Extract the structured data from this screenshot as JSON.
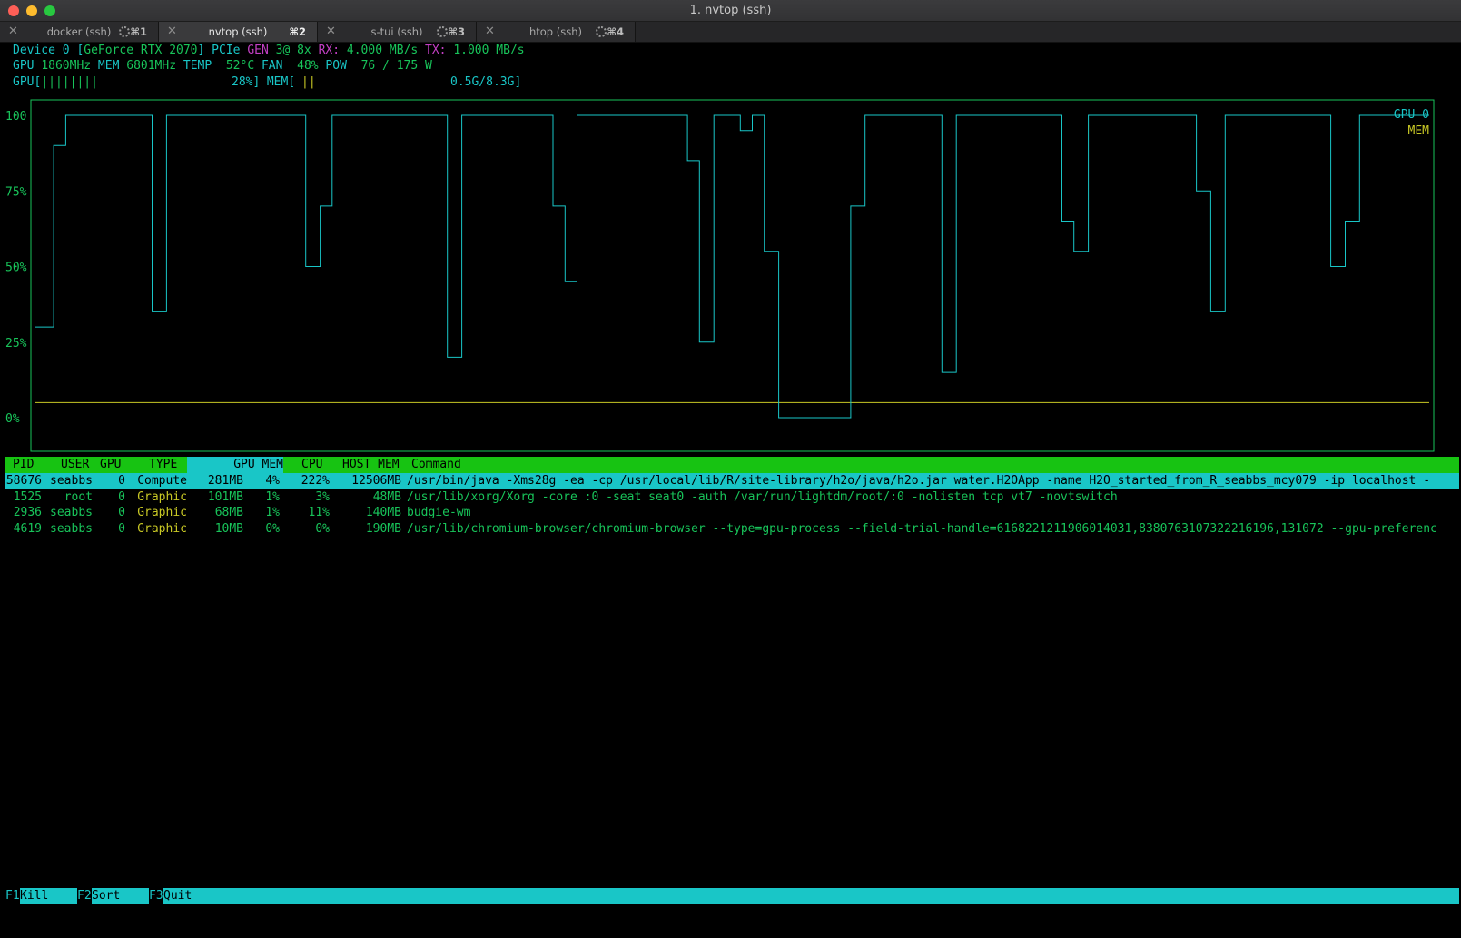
{
  "window": {
    "title": "1. nvtop (ssh)"
  },
  "tabs": [
    {
      "label": "docker (ssh)",
      "shortcut": "⌘1",
      "active": false,
      "busy": true
    },
    {
      "label": "nvtop (ssh)",
      "shortcut": "⌘2",
      "active": true,
      "busy": false
    },
    {
      "label": "s-tui (ssh)",
      "shortcut": "⌘3",
      "active": false,
      "busy": true
    },
    {
      "label": "htop (ssh)",
      "shortcut": "⌘4",
      "active": false,
      "busy": true
    }
  ],
  "device": {
    "prefix": "Device 0 [",
    "name": "GeForce RTX 2070",
    "pcie_label": "] PCIe ",
    "gen_label": "GEN ",
    "gen_value": "3@ 8x ",
    "rx_label": "RX: ",
    "rx_value": "4.000 MB/s ",
    "tx_label": "TX: ",
    "tx_value": "1.000 MB/s"
  },
  "stats": {
    "gpu_label": "GPU ",
    "gpu_clock": "1860MHz",
    "mem_label": " MEM ",
    "mem_clock": "6801MHz",
    "temp_label": " TEMP  ",
    "temp_value": "52°C",
    "fan_label": " FAN  ",
    "fan_value": "48%",
    "pow_label": " POW  ",
    "pow_value": "76 / 175 W"
  },
  "bars": {
    "gpu_label": "GPU[",
    "gpu_bar": "||||||||",
    "gpu_value": "28%]",
    "mem_label": " MEM[",
    "mem_bar": "||",
    "mem_value": "0.5G/8.3G]"
  },
  "chart_data": {
    "type": "line",
    "ylim": [
      0,
      100
    ],
    "yticks": [
      "100",
      "75%",
      "50%",
      "25%",
      "0%"
    ],
    "series": [
      {
        "name": "GPU 0",
        "color": "#19c6c7",
        "values": [
          30,
          30,
          30,
          30,
          30,
          30,
          30,
          30,
          90,
          90,
          90,
          90,
          90,
          100,
          100,
          100,
          100,
          100,
          100,
          100,
          100,
          100,
          100,
          100,
          100,
          100,
          100,
          100,
          100,
          100,
          100,
          100,
          100,
          100,
          100,
          100,
          100,
          100,
          100,
          100,
          100,
          100,
          100,
          100,
          100,
          100,
          100,
          100,
          100,
          35,
          35,
          35,
          35,
          35,
          35,
          100,
          100,
          100,
          100,
          100,
          100,
          100,
          100,
          100,
          100,
          100,
          100,
          100,
          100,
          100,
          100,
          100,
          100,
          100,
          100,
          100,
          100,
          100,
          100,
          100,
          100,
          100,
          100,
          100,
          100,
          100,
          100,
          100,
          100,
          100,
          100,
          100,
          100,
          100,
          100,
          100,
          100,
          100,
          100,
          100,
          100,
          100,
          100,
          100,
          100,
          100,
          100,
          100,
          100,
          100,
          100,
          100,
          100,
          50,
          50,
          50,
          50,
          50,
          50,
          70,
          70,
          70,
          70,
          70,
          100,
          100,
          100,
          100,
          100,
          100,
          100,
          100,
          100,
          100,
          100,
          100,
          100,
          100,
          100,
          100,
          100,
          100,
          100,
          100,
          100,
          100,
          100,
          100,
          100,
          100,
          100,
          100,
          100,
          100,
          100,
          100,
          100,
          100,
          100,
          100,
          100,
          100,
          100,
          100,
          100,
          100,
          100,
          100,
          100,
          100,
          100,
          100,
          20,
          20,
          20,
          20,
          20,
          20,
          100,
          100,
          100,
          100,
          100,
          100,
          100,
          100,
          100,
          100,
          100,
          100,
          100,
          100,
          100,
          100,
          100,
          100,
          100,
          100,
          100,
          100,
          100,
          100,
          100,
          100,
          100,
          100,
          100,
          100,
          100,
          100,
          100,
          100,
          100,
          100,
          100,
          100,
          70,
          70,
          70,
          70,
          70,
          45,
          45,
          45,
          45,
          45,
          100,
          100,
          100,
          100,
          100,
          100,
          100,
          100,
          100,
          100,
          100,
          100,
          100,
          100,
          100,
          100,
          100,
          100,
          100,
          100,
          100,
          100,
          100,
          100,
          100,
          100,
          100,
          100,
          100,
          100,
          100,
          100,
          100,
          100,
          100,
          100,
          100,
          100,
          100,
          100,
          100,
          100,
          100,
          100,
          100,
          100,
          85,
          85,
          85,
          85,
          85,
          25,
          25,
          25,
          25,
          25,
          25,
          100,
          100,
          100,
          100,
          100,
          100,
          100,
          100,
          100,
          100,
          100,
          95,
          95,
          95,
          95,
          95,
          100,
          100,
          100,
          100,
          100,
          55,
          55,
          55,
          55,
          55,
          55,
          0,
          0,
          0,
          0,
          0,
          0,
          0,
          0,
          0,
          0,
          0,
          0,
          0,
          0,
          0,
          0,
          0,
          0,
          0,
          0,
          0,
          0,
          0,
          0,
          0,
          0,
          0,
          0,
          0,
          0,
          70,
          70,
          70,
          70,
          70,
          70,
          100,
          100,
          100,
          100,
          100,
          100,
          100,
          100,
          100,
          100,
          100,
          100,
          100,
          100,
          100,
          100,
          100,
          100,
          100,
          100,
          100,
          100,
          100,
          100,
          100,
          100,
          100,
          100,
          100,
          100,
          100,
          100,
          15,
          15,
          15,
          15,
          15,
          15,
          100,
          100,
          100,
          100,
          100,
          100,
          100,
          100,
          100,
          100,
          100,
          100,
          100,
          100,
          100,
          100,
          100,
          100,
          100,
          100,
          100,
          100,
          100,
          100,
          100,
          100,
          100,
          100,
          100,
          100,
          100,
          100,
          100,
          100,
          100,
          100,
          100,
          100,
          100,
          100,
          100,
          100,
          100,
          100,
          65,
          65,
          65,
          65,
          65,
          55,
          55,
          55,
          55,
          55,
          55,
          100,
          100,
          100,
          100,
          100,
          100,
          100,
          100,
          100,
          100,
          100,
          100,
          100,
          100,
          100,
          100,
          100,
          100,
          100,
          100,
          100,
          100,
          100,
          100,
          100,
          100,
          100,
          100,
          100,
          100,
          100,
          100,
          100,
          100,
          100,
          100,
          100,
          100,
          100,
          100,
          100,
          100,
          100,
          100,
          100,
          75,
          75,
          75,
          75,
          75,
          75,
          35,
          35,
          35,
          35,
          35,
          35,
          100,
          100,
          100,
          100,
          100,
          100,
          100,
          100,
          100,
          100,
          100,
          100,
          100,
          100,
          100,
          100,
          100,
          100,
          100,
          100,
          100,
          100,
          100,
          100,
          100,
          100,
          100,
          100,
          100,
          100,
          100,
          100,
          100,
          100,
          100,
          100,
          100,
          100,
          100,
          100,
          100,
          100,
          100,
          100,
          50,
          50,
          50,
          50,
          50,
          50,
          65,
          65,
          65,
          65,
          65,
          65,
          100,
          100,
          100,
          100,
          100,
          100,
          100,
          100,
          100,
          100,
          100,
          100,
          100,
          100,
          100,
          100,
          100,
          100,
          100,
          100,
          100,
          100,
          100,
          100,
          100,
          100,
          100,
          100,
          100
        ]
      },
      {
        "name": "MEM",
        "color": "#c8c825",
        "constant": 5
      }
    ]
  },
  "process_table": {
    "columns": {
      "pid": "PID",
      "user": "USER",
      "gpu": "GPU",
      "type": "TYPE",
      "gpu_mem": "GPU MEM",
      "cpu": "CPU",
      "host_mem": "HOST MEM",
      "command": "Command"
    },
    "rows": [
      {
        "pid": "58676",
        "user": "seabbs",
        "gpu": "0",
        "type": "Compute",
        "gpu_mem": "281MB",
        "mem_pct": "4%",
        "cpu": "222%",
        "host_mem": "12506MB",
        "command": "/usr/bin/java -Xms28g -ea -cp /usr/local/lib/R/site-library/h2o/java/h2o.jar water.H2OApp -name H2O_started_from_R_seabbs_mcy079 -ip localhost -"
      },
      {
        "pid": "1525",
        "user": "root",
        "gpu": "0",
        "type": "Graphic",
        "gpu_mem": "101MB",
        "mem_pct": "1%",
        "cpu": "3%",
        "host_mem": "48MB",
        "command": "/usr/lib/xorg/Xorg -core :0 -seat seat0 -auth /var/run/lightdm/root/:0 -nolisten tcp vt7 -novtswitch"
      },
      {
        "pid": "2936",
        "user": "seabbs",
        "gpu": "0",
        "type": "Graphic",
        "gpu_mem": "68MB",
        "mem_pct": "1%",
        "cpu": "11%",
        "host_mem": "140MB",
        "command": "budgie-wm"
      },
      {
        "pid": "4619",
        "user": "seabbs",
        "gpu": "0",
        "type": "Graphic",
        "gpu_mem": "10MB",
        "mem_pct": "0%",
        "cpu": "0%",
        "host_mem": "190MB",
        "command": "/usr/lib/chromium-browser/chromium-browser --type=gpu-process --field-trial-handle=6168221211906014031,8380763107322216196,131072 --gpu-preferenc"
      }
    ]
  },
  "footer": [
    {
      "key": "F1",
      "label": "Kill"
    },
    {
      "key": "F2",
      "label": "Sort"
    },
    {
      "key": "F3",
      "label": "Quit"
    }
  ]
}
